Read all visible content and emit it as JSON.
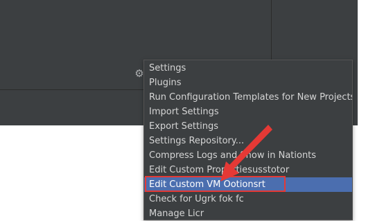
{
  "menu": {
    "items": [
      {
        "label": "Settings"
      },
      {
        "label": "Plugins"
      },
      {
        "label": "Run Configuration Templates for New Projects"
      },
      {
        "label": "Import Settings"
      },
      {
        "label": "Export Settings"
      },
      {
        "label": "Settings Repository..."
      },
      {
        "label": "Compress Logs and Show in Nationts"
      },
      {
        "label": "Edit Custom Propertiesusstotor"
      },
      {
        "label": "Edit Custom VM Ootionsrt"
      },
      {
        "label": "Check for Ugrk fok fc"
      },
      {
        "label": "Manage Licr"
      }
    ],
    "selected_index": 8
  },
  "icons": {
    "gear": "gear-icon"
  },
  "colors": {
    "panel_bg": "#3c3f41",
    "menu_text": "#d5d5d5",
    "selection": "#4b6eaf",
    "annotation": "#e53935"
  }
}
